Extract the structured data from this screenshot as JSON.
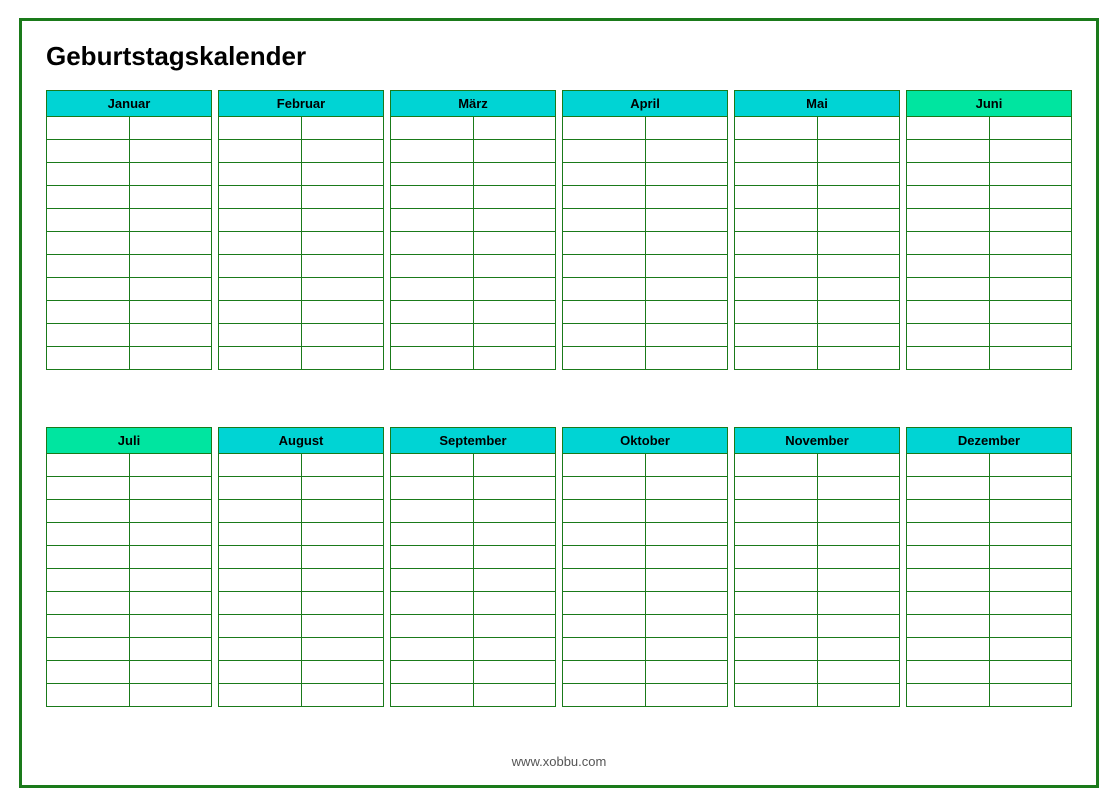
{
  "title": "Geburtstagskalender",
  "months_top": [
    {
      "label": "Januar",
      "color": "cyan"
    },
    {
      "label": "Februar",
      "color": "cyan"
    },
    {
      "label": "März",
      "color": "cyan"
    },
    {
      "label": "April",
      "color": "cyan"
    },
    {
      "label": "Mai",
      "color": "cyan"
    },
    {
      "label": "Juni",
      "color": "green"
    }
  ],
  "months_bottom": [
    {
      "label": "Juli",
      "color": "green"
    },
    {
      "label": "August",
      "color": "cyan"
    },
    {
      "label": "September",
      "color": "cyan"
    },
    {
      "label": "Oktober",
      "color": "cyan"
    },
    {
      "label": "November",
      "color": "cyan"
    },
    {
      "label": "Dezember",
      "color": "cyan"
    }
  ],
  "rows_count": 11,
  "cells_per_row": 2,
  "footer": "www.xobbu.com"
}
